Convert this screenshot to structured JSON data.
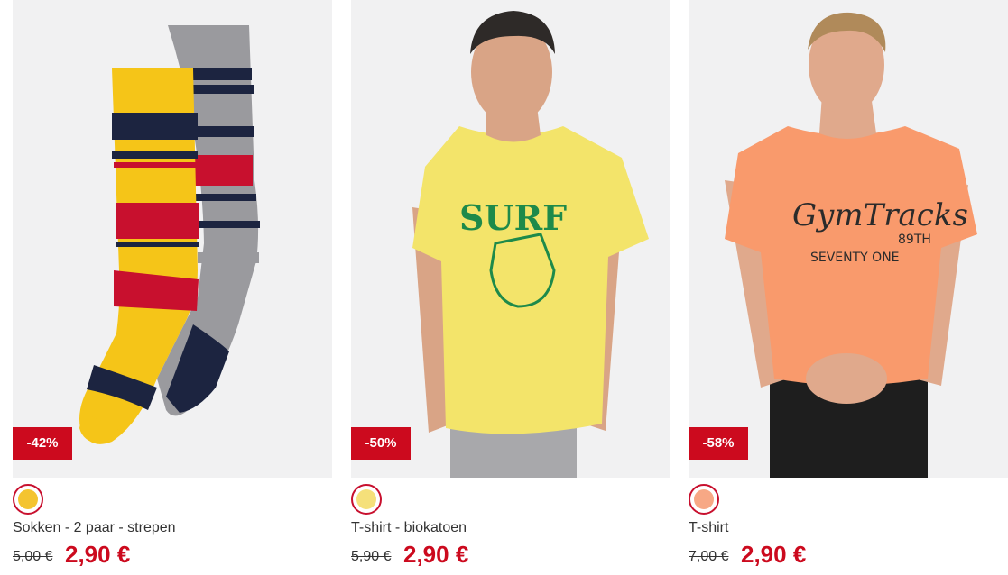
{
  "products": [
    {
      "name": "Sokken - 2 paar - strepen",
      "discount": "-42%",
      "old_price": "5,00 €",
      "new_price": "2,90 €",
      "swatch_color": "#f4c430",
      "image": "striped-socks-image"
    },
    {
      "name": "T-shirt - biokatoen",
      "discount": "-50%",
      "old_price": "5,90 €",
      "new_price": "2,90 €",
      "swatch_color": "#f5e07a",
      "image": "yellow-surf-tshirt-image"
    },
    {
      "name": "T-shirt",
      "discount": "-58%",
      "old_price": "7,00 €",
      "new_price": "2,90 €",
      "swatch_color": "#f7a885",
      "image": "orange-gymtracks-tshirt-image"
    }
  ],
  "colors": {
    "sale_red": "#cc0a1e",
    "image_background": "#f1f1f2"
  }
}
